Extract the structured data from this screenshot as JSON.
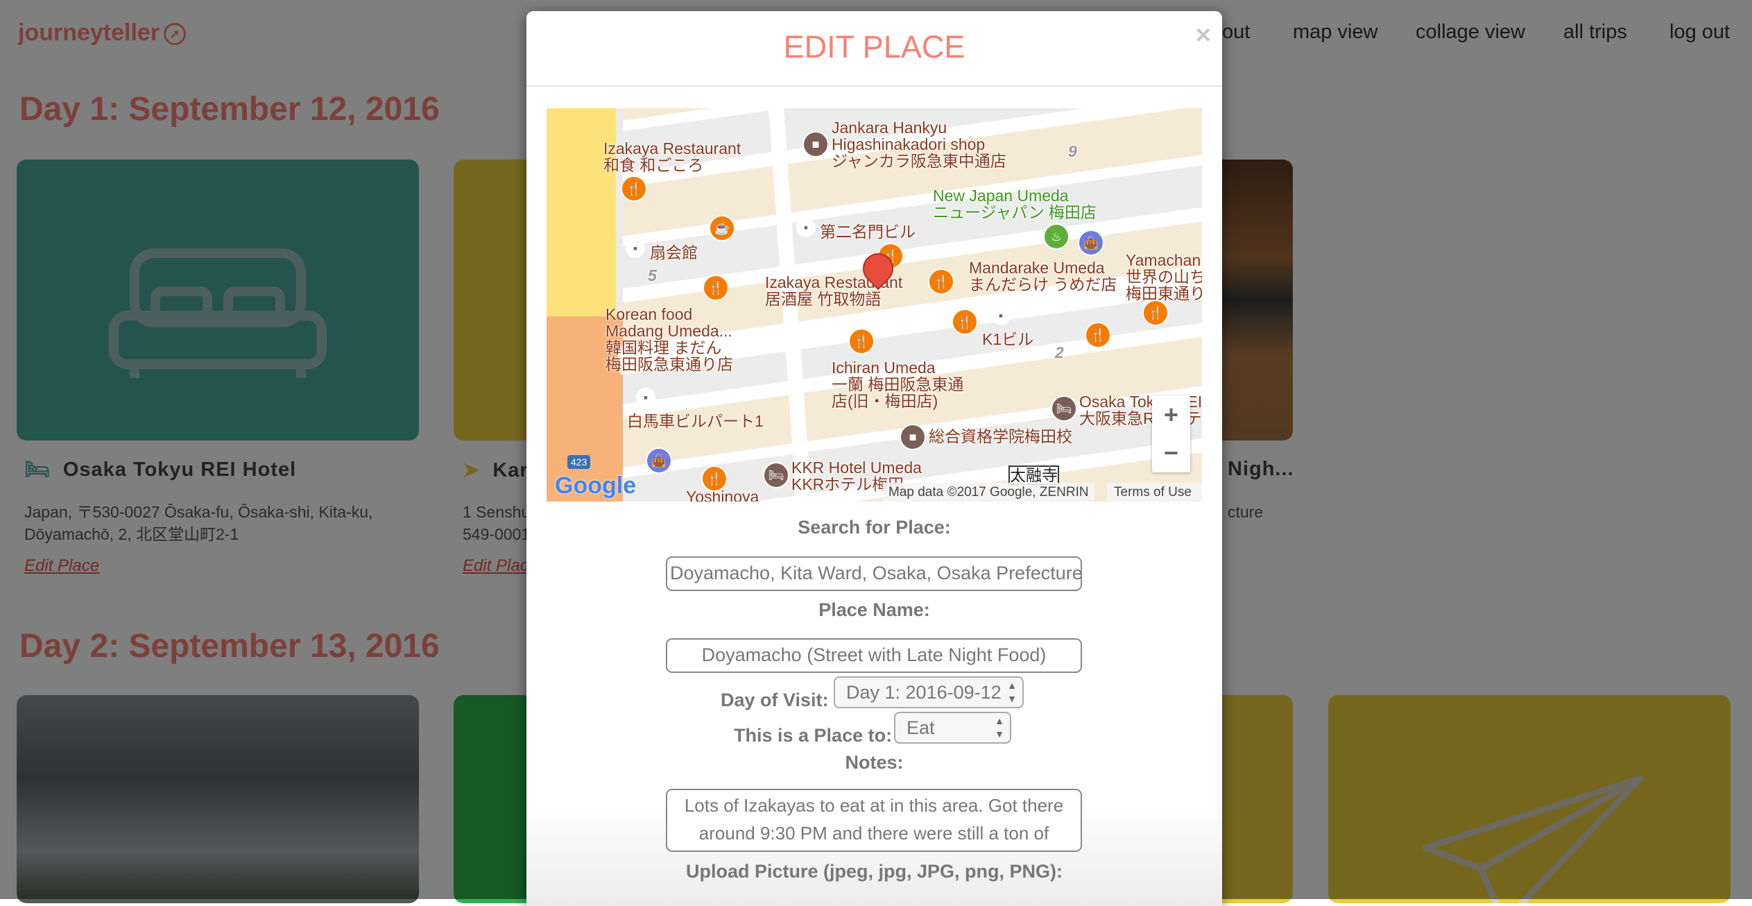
{
  "nav": {
    "brand": "journeyteller",
    "items": [
      "out",
      "map view",
      "collage view",
      "all trips",
      "log out"
    ]
  },
  "days": [
    {
      "heading": "Day 1: September 12, 2016",
      "cards": [
        {
          "title": "Osaka Tokyu REI Hotel",
          "address_lines": [
            "Japan, 〒530-0027 Ōsaka-fu, Ōsaka-shi, Kita-ku,",
            "Dōyamachō, 2, 北区堂山町2-1"
          ],
          "edit": "Edit Place",
          "icon": "bed-icon"
        },
        {
          "title": "Kar",
          "address_lines": [
            "1 Senshu",
            "549-0001"
          ],
          "edit": "Edit Plac",
          "icon": "paper-plane-icon"
        },
        {
          "title": "Nigh...",
          "address_lines": [
            "cture"
          ]
        }
      ]
    },
    {
      "heading": "Day 2: September 13, 2016"
    }
  ],
  "modal": {
    "title": "EDIT PLACE",
    "close": "×",
    "map": {
      "labels": [
        "Izakaya Restaurant\n和食 和ごころ",
        "Jankara Hankyu\nHigashinakadori shop\nジャンカラ阪急東中通店",
        "New Japan Umeda\nニュージャパン 梅田店",
        "第二名門ビル",
        "扇会館",
        "Izakaya Restaurant\n居酒屋 竹取物語",
        "Mandarake Umeda\nまんだらけ うめだ店",
        "Yamachan\n世界の山ち\n梅田東通り",
        "Korean food\nMadang Umeda...\n韓国料理 まだん\n梅田阪急東通り店",
        "Ichiran Umeda\n一蘭 梅田阪急東通\n店(旧・梅田店)",
        "K1ビル",
        "Osaka Tokyu REI\n大阪東急REIホテル",
        "白馬車ビルパート1",
        "総合資格学院梅田校",
        "KKR Hotel Umeda\nKKRホテル梅田",
        "Yoshinoya",
        "9",
        "5",
        "2",
        "太融寺"
      ],
      "attribution": "Map data ©2017 Google, ZENRIN",
      "terms": "Terms of Use",
      "zoom_in": "+",
      "zoom_out": "−",
      "google": "Google",
      "route": "423"
    },
    "form": {
      "search_label": "Search for Place:",
      "search_value": "Doyamacho, Kita Ward, Osaka, Osaka Prefecture",
      "name_label": "Place Name:",
      "name_value": "Doyamacho (Street with Late Night Food)",
      "day_label": "Day of Visit:",
      "day_value": "Day 1: 2016-09-12",
      "type_label": "This is a Place to:",
      "type_value": "Eat",
      "notes_label": "Notes:",
      "notes_value": "Lots of Izakayas to eat at in this area. Got there around 9:30 PM and there were still a ton of",
      "upload_label": "Upload Picture (jpeg, jpg, JPG, png, PNG):"
    }
  },
  "colors": {
    "brand": "#fa8072",
    "teal": "#4aa89f",
    "yellow": "#ead03c",
    "green": "#2fb34f"
  }
}
